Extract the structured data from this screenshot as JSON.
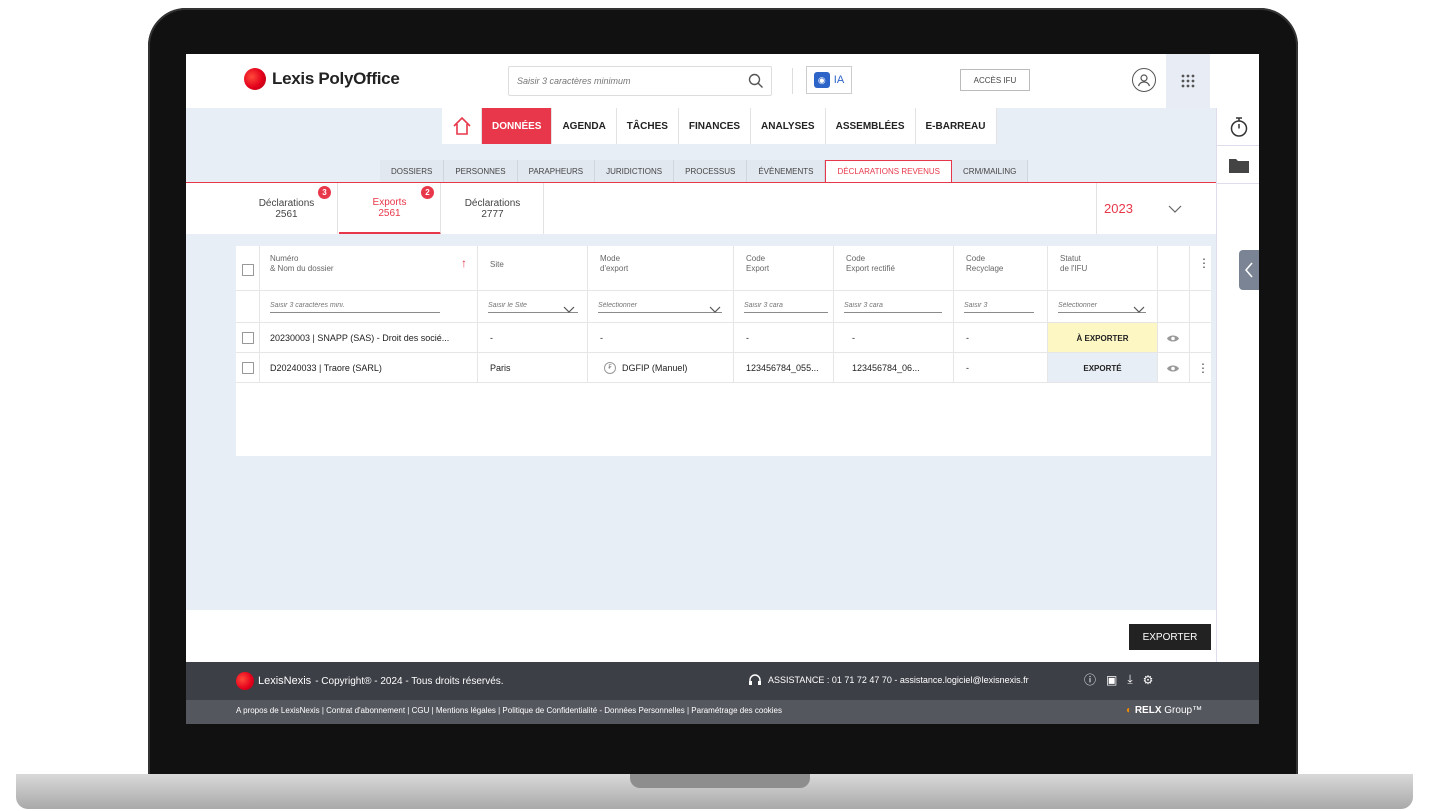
{
  "header": {
    "logo_text": "Lexis PolyOffice",
    "search_placeholder": "Saisir 3 caractères minimum",
    "ia_label": "IA",
    "acces_label": "ACCÈS IFU"
  },
  "main_nav": [
    {
      "label": "DONNÉES",
      "active": true
    },
    {
      "label": "AGENDA"
    },
    {
      "label": "TÂCHES"
    },
    {
      "label": "FINANCES"
    },
    {
      "label": "ANALYSES"
    },
    {
      "label": "ASSEMBLÉES"
    },
    {
      "label": "E-BARREAU"
    }
  ],
  "sub_nav": [
    {
      "label": "DOSSIERS"
    },
    {
      "label": "PERSONNES"
    },
    {
      "label": "PARAPHEURS"
    },
    {
      "label": "JURIDICTIONS"
    },
    {
      "label": "PROCESSUS"
    },
    {
      "label": "ÉVÈNEMENTS"
    },
    {
      "label": "DÉCLARATIONS REVENUS",
      "active": true
    },
    {
      "label": "CRM/MAILING"
    }
  ],
  "decl_tabs": [
    {
      "label": "Déclarations",
      "count": "2561",
      "badge": "3"
    },
    {
      "label": "Exports",
      "count": "2561",
      "badge": "2",
      "active": true
    },
    {
      "label": "Déclarations",
      "count": "2777"
    }
  ],
  "year": "2023",
  "table": {
    "headers": {
      "numero_l1": "Numéro",
      "numero_l2": "& Nom du dossier",
      "site": "Site",
      "mode_l1": "Mode",
      "mode_l2": "d'export",
      "code_export_l1": "Code",
      "code_export_l2": "Export",
      "code_rect_l1": "Code",
      "code_rect_l2": "Export rectifié",
      "code_recy_l1": "Code",
      "code_recy_l2": "Recyclage",
      "statut_l1": "Statut",
      "statut_l2": "de l'IFU"
    },
    "filters": {
      "numero": "Saisir 3 caractères mini.",
      "site": "Saisir le Site",
      "mode": "Sélectionner",
      "code_export": "Saisir 3 cara",
      "code_rect": "Saisir 3 cara",
      "code_recy": "Saisir 3",
      "statut": "Sélectionner"
    },
    "rows": [
      {
        "numero": "20230003 | SNAPP (SAS) - Droit des socié...",
        "site": "-",
        "mode": "-",
        "code_export": "-",
        "code_rect": "-",
        "code_recy": "-",
        "statut": "À EXPORTER"
      },
      {
        "numero": "D20240033 | Traore (SARL)",
        "site": "Paris",
        "mode": "DGFIP (Manuel)",
        "code_export": "123456784_055...",
        "code_rect": "123456784_06...",
        "code_recy": "-",
        "statut": "EXPORTÉ"
      }
    ]
  },
  "export_button": "EXPORTER",
  "footer": {
    "brand": "LexisNexis",
    "copyright": "- Copyright® - 2024 - Tous droits réservés.",
    "assistance": "ASSISTANCE : 01 71 72 47 70 - assistance.logiciel@lexisnexis.fr",
    "links": "A propos de LexisNexis | Contrat d'abonnement | CGU | Mentions légales | Politique de Confidentialité - Données Personnelles | Paramétrage des cookies",
    "relx": "RELX",
    "relx_group": "Group™"
  },
  "colors": {
    "accent": "#e8374a",
    "band": "#e8eef6",
    "footer": "#3d3f47"
  }
}
